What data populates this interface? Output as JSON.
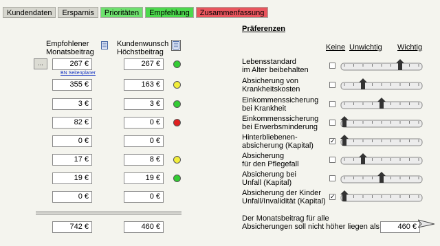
{
  "tabs": [
    {
      "label": "Kundendaten",
      "style": "gray"
    },
    {
      "label": "Ersparnis",
      "style": "gray"
    },
    {
      "label": "Prioritäten",
      "style": "green"
    },
    {
      "label": "Empfehlung",
      "style": "active"
    },
    {
      "label": "Zusammenfassung",
      "style": "red"
    }
  ],
  "left": {
    "col1_header": [
      "Empfohlener",
      "Monatsbeitrag"
    ],
    "col2_header": [
      "Kundenwunsch",
      "Höchstbeitrag"
    ],
    "ellipsis_button": "...",
    "planner_link": "BN Seitenplaner",
    "rows": [
      {
        "recommended": "267 €",
        "desired": "267 €",
        "status": "green"
      },
      {
        "recommended": "355 €",
        "desired": "163 €",
        "status": "yellow"
      },
      {
        "recommended": "3 €",
        "desired": "3 €",
        "status": "green"
      },
      {
        "recommended": "82 €",
        "desired": "0 €",
        "status": "red"
      },
      {
        "recommended": "0 €",
        "desired": "0 €",
        "status": ""
      },
      {
        "recommended": "17 €",
        "desired": "8 €",
        "status": "yellow"
      },
      {
        "recommended": "19 €",
        "desired": "19 €",
        "status": "green"
      },
      {
        "recommended": "0 €",
        "desired": "0 €",
        "status": ""
      }
    ],
    "total_recommended": "742 €",
    "total_desired": "460 €"
  },
  "prefs": {
    "title": "Präferenzen",
    "level_none": "Keine",
    "level_low": "Unwichtig",
    "level_high": "Wichtig",
    "items": [
      {
        "label": [
          "Lebensstandard",
          "im Alter beibehalten"
        ],
        "checked": false,
        "level": 0.75
      },
      {
        "label": [
          "Absicherung von",
          "Krankheitskosten"
        ],
        "checked": false,
        "level": 0.25
      },
      {
        "label": [
          "Einkommenssicherung",
          "bei Krankheit"
        ],
        "checked": false,
        "level": 0.5
      },
      {
        "label": [
          "Einkommenssicherung",
          "bei Erwerbsminderung"
        ],
        "checked": false,
        "level": 0
      },
      {
        "label": [
          "Hinterbliebenen-",
          "absicherung (Kapital)"
        ],
        "checked": true,
        "level": 0
      },
      {
        "label": [
          "Absicherung",
          "für den Pflegefall"
        ],
        "checked": false,
        "level": 0.25
      },
      {
        "label": [
          "Absicherung bei",
          "Unfall (Kapital)"
        ],
        "checked": false,
        "level": 0.5
      },
      {
        "label": [
          "Absicherung der Kinder",
          "Unfall/Invalidität (Kapital)"
        ],
        "checked": true,
        "level": 0
      }
    ],
    "bottom_text": [
      "Der Monatsbeitrag für alle",
      "Absicherungen soll nicht höher liegen als:"
    ],
    "max_value": "460 €"
  },
  "colors": {
    "green": "#33cc33",
    "yellow": "#f2ee3a",
    "red": "#e02020"
  }
}
